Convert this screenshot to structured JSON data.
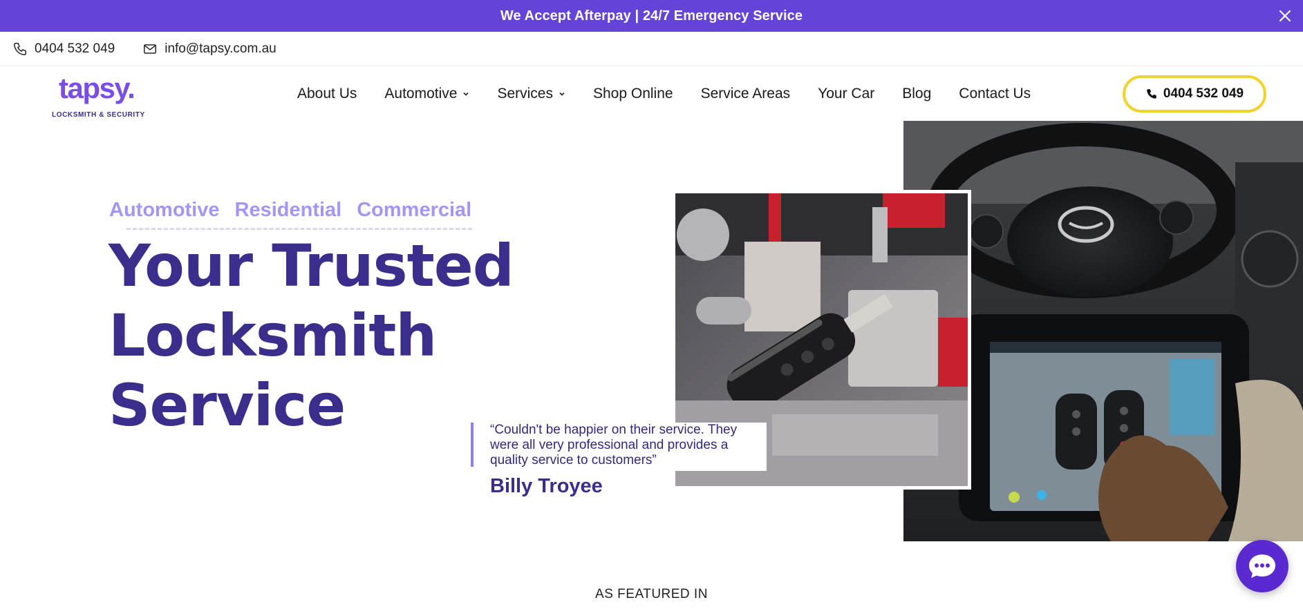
{
  "announcement": {
    "text": "We Accept Afterpay | 24/7 Emergency Service",
    "close_icon": "close-icon"
  },
  "contact_bar": {
    "phone": "0404 532 049",
    "email": "info@tapsy.com.au",
    "phone_icon": "phone-icon",
    "email_icon": "envelope-icon"
  },
  "header": {
    "logo": {
      "word": "tapsy.",
      "tagline": "LOCKSMITH & SECURITY"
    },
    "nav": [
      {
        "label": "About Us",
        "dropdown": false
      },
      {
        "label": "Automotive",
        "dropdown": true
      },
      {
        "label": "Services",
        "dropdown": true
      },
      {
        "label": "Shop Online",
        "dropdown": false
      },
      {
        "label": "Service Areas",
        "dropdown": false
      },
      {
        "label": "Your Car",
        "dropdown": false
      },
      {
        "label": "Blog",
        "dropdown": false
      },
      {
        "label": "Contact Us",
        "dropdown": false
      }
    ],
    "cta_phone": "0404 532 049"
  },
  "hero": {
    "categories": [
      "Automotive",
      "Residential",
      "Commercial"
    ],
    "title_lines": [
      "Your Trusted",
      "Locksmith",
      "Service"
    ],
    "testimonial": {
      "quote": "“Couldn't be happier on their service. They were all very professional and provides a quality service to customers”",
      "author": "Billy Troyee"
    }
  },
  "featured": {
    "label": "AS FEATURED IN"
  },
  "colors": {
    "brand_purple": "#6343d8",
    "title_navy": "#3a2e8c",
    "category_lavender": "#a695f5",
    "cta_border_yellow": "#f2d22b",
    "chat_purple": "#5a2ad0"
  }
}
